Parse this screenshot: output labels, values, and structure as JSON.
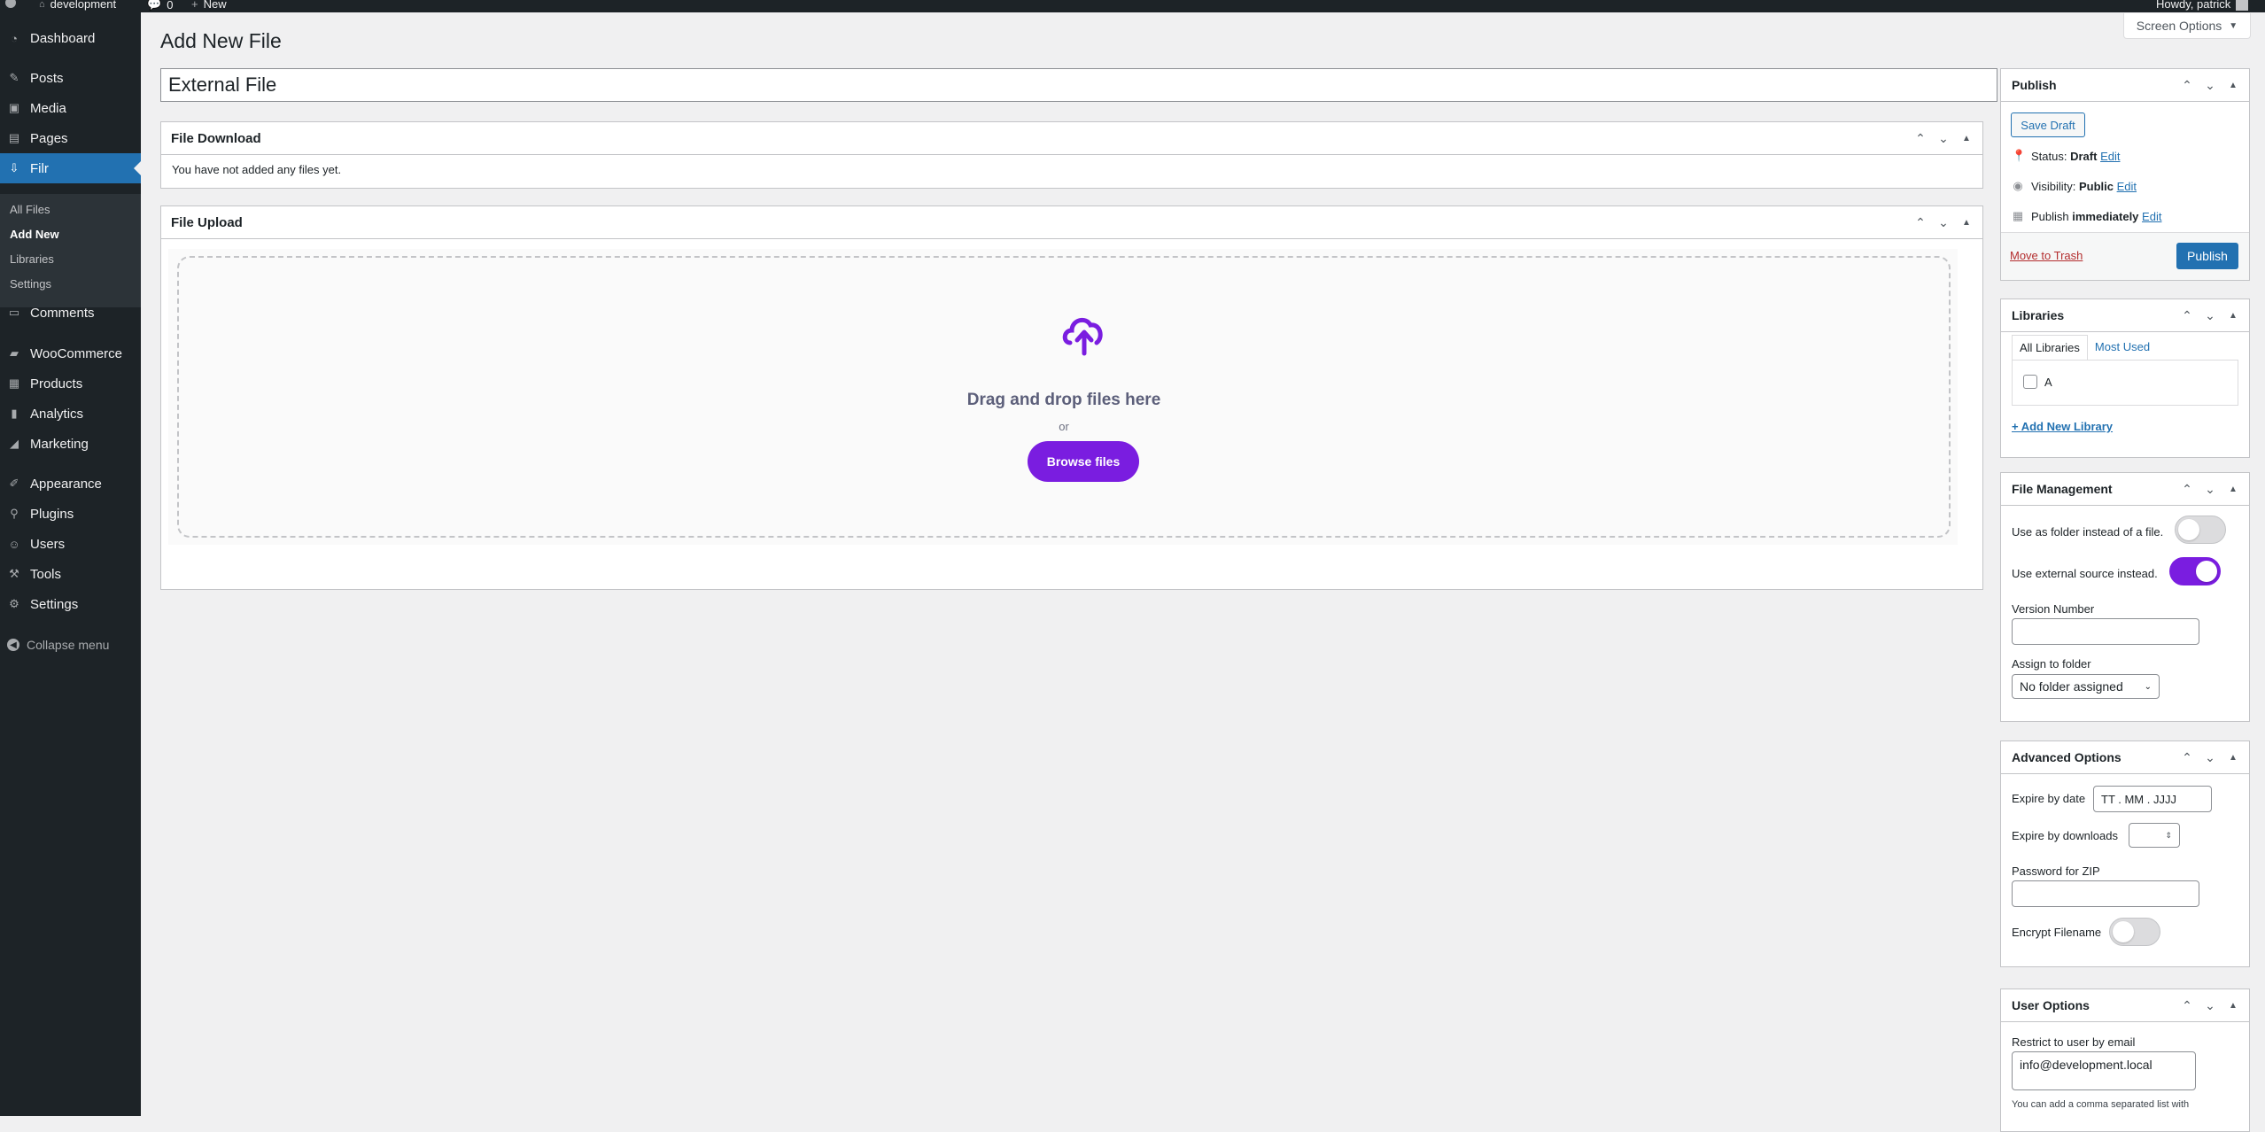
{
  "admin_bar": {
    "site_name": "development",
    "comments_count": "0",
    "new_label": "New",
    "howdy": "Howdy, patrick"
  },
  "sidebar": {
    "items": [
      {
        "label": "Dashboard",
        "icon": "dashboard-icon"
      },
      {
        "label": "Posts",
        "icon": "pin-icon"
      },
      {
        "label": "Media",
        "icon": "media-icon"
      },
      {
        "label": "Pages",
        "icon": "pages-icon"
      },
      {
        "label": "Filr",
        "icon": "filr-icon"
      },
      {
        "label": "Comments",
        "icon": "comments-icon"
      },
      {
        "label": "WooCommerce",
        "icon": "woocommerce-icon"
      },
      {
        "label": "Products",
        "icon": "products-icon"
      },
      {
        "label": "Analytics",
        "icon": "analytics-icon"
      },
      {
        "label": "Marketing",
        "icon": "marketing-icon"
      },
      {
        "label": "Appearance",
        "icon": "appearance-icon"
      },
      {
        "label": "Plugins",
        "icon": "plugins-icon"
      },
      {
        "label": "Users",
        "icon": "users-icon"
      },
      {
        "label": "Tools",
        "icon": "tools-icon"
      },
      {
        "label": "Settings",
        "icon": "settings-icon"
      }
    ],
    "submenu": [
      "All Files",
      "Add New",
      "Libraries",
      "Settings"
    ],
    "collapse_label": "Collapse menu"
  },
  "screen_options": "Screen Options",
  "page_title": "Add New File",
  "title_value": "External File",
  "file_download": {
    "title": "File Download",
    "empty_text": "You have not added any files yet."
  },
  "file_upload": {
    "title": "File Upload",
    "drop_text": "Drag and drop files here",
    "or_text": "or",
    "browse_label": "Browse files"
  },
  "publish": {
    "title": "Publish",
    "save_draft": "Save Draft",
    "status_label": "Status:",
    "status_value": "Draft",
    "visibility_label": "Visibility:",
    "visibility_value": "Public",
    "publish_label": "Publish",
    "publish_value": "immediately",
    "edit": "Edit",
    "trash": "Move to Trash",
    "publish_button": "Publish"
  },
  "libraries": {
    "title": "Libraries",
    "tab_all": "All Libraries",
    "tab_most": "Most Used",
    "item": "A",
    "add_new": "+ Add New Library"
  },
  "file_management": {
    "title": "File Management",
    "folder_label": "Use as folder instead of a file.",
    "folder_on": false,
    "external_label": "Use external source instead.",
    "external_on": true,
    "version_label": "Version Number",
    "version_value": "",
    "folder_assign_label": "Assign to folder",
    "folder_assign_value": "No folder assigned"
  },
  "advanced_options": {
    "title": "Advanced Options",
    "expire_date_label": "Expire by date",
    "expire_date_placeholder": "TT . MM . JJJJ",
    "expire_downloads_label": "Expire by downloads",
    "password_label": "Password for ZIP",
    "encrypt_label": "Encrypt Filename",
    "encrypt_on": false
  },
  "user_options": {
    "title": "User Options",
    "restrict_label": "Restrict to user by email",
    "restrict_value": "info@development.local",
    "help_text": "You can add a comma separated list with"
  },
  "colors": {
    "wp_blue": "#2271b1",
    "purple": "#7a1de0",
    "admin_dark": "#1d2327",
    "trash_red": "#b32d2e"
  }
}
